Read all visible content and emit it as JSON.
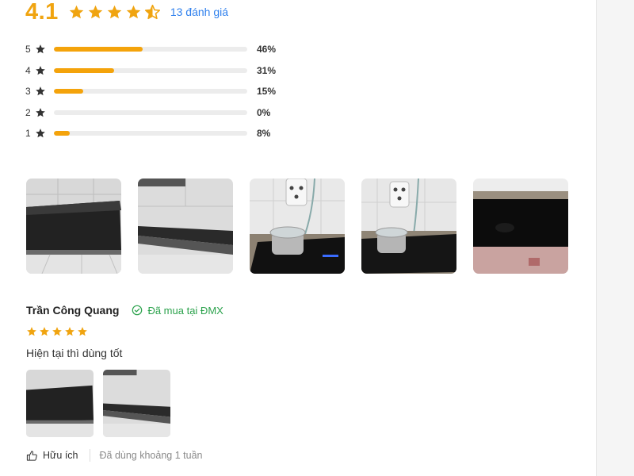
{
  "summary": {
    "score": "4.1",
    "stars_value": 4.5,
    "review_count_label": "13 đánh giá"
  },
  "distribution": [
    {
      "star": "5",
      "percent_label": "46%",
      "fill": 0.46
    },
    {
      "star": "4",
      "percent_label": "31%",
      "fill": 0.31
    },
    {
      "star": "3",
      "percent_label": "15%",
      "fill": 0.15
    },
    {
      "star": "2",
      "percent_label": "0%",
      "fill": 0.0
    },
    {
      "star": "1",
      "percent_label": "8%",
      "fill": 0.08
    }
  ],
  "gallery": {
    "images": [
      "stove-photo",
      "stove-photo",
      "pot-on-stove-photo",
      "pot-on-stove-photo",
      "stove-black-photo"
    ]
  },
  "review": {
    "reviewer_name": "Trần Công Quang",
    "verified_label": "Đã mua tại ĐMX",
    "stars": 5,
    "text": "Hiện tại thì dùng tốt",
    "helpful_label": "Hữu ích",
    "usage_label": "Đã dùng khoảng 1 tuần"
  },
  "colors": {
    "accent": "#f0a410",
    "bar_fill": "#f4a30b",
    "link": "#2f80ed",
    "verified": "#2ba24c"
  }
}
